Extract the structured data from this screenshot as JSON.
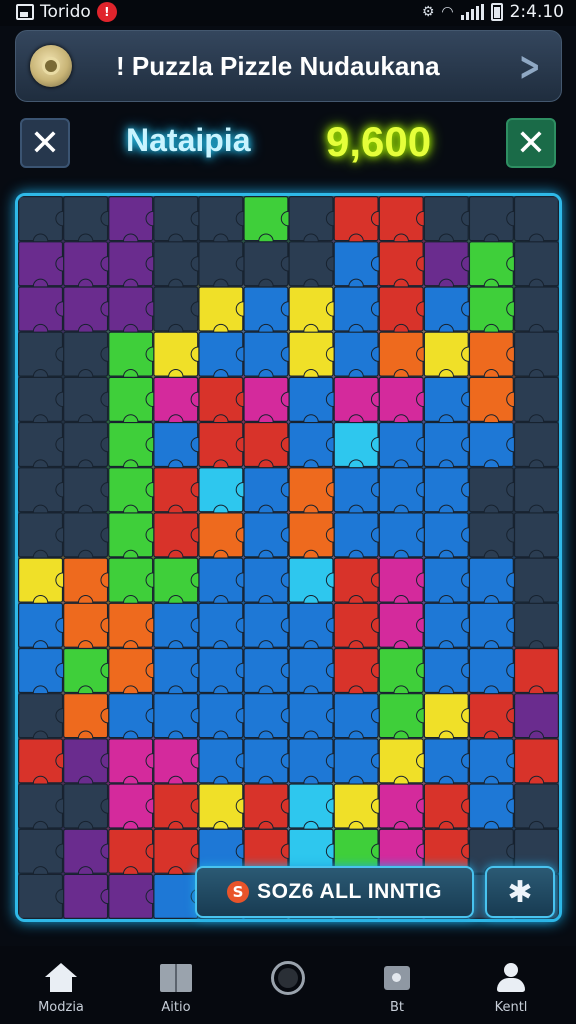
{
  "status_bar": {
    "app_text": "Torido",
    "notification_glyph": "!",
    "time": "2:4.10",
    "icons": [
      "image-icon",
      "notification-badge-icon",
      "vibrate-icon",
      "wifi-icon",
      "signal-icon",
      "battery-icon"
    ]
  },
  "title_bar": {
    "title": "! Puzzla Pizzle Nudaukana",
    "logo_icon": "puzzle-logo-icon",
    "next_icon": "chevron-right-icon"
  },
  "hud": {
    "player_name": "Nataipia",
    "score": "9,600",
    "left_button_icon": "tools-icon",
    "right_button_icon": "shuffle-icon"
  },
  "board": {
    "grid": {
      "columns": 12,
      "rows": 16
    },
    "colors": {
      "frame_glow": "#2fb9e8",
      "slate": "#2b3d52",
      "blue": "#1e78d6",
      "cyan": "#2ec7ee",
      "green": "#3fcf3a",
      "yellow": "#f0e028",
      "red": "#d8332a",
      "orange": "#ee6a1e",
      "magenta": "#d42a9c",
      "purple": "#6a2c8e",
      "gray": "#5d6670"
    },
    "placed_color_map": [
      "SSPSSGSRRSSS",
      "PPPSSSSBRPGS",
      "PPPSYBYBRBGS",
      "SSGYBBYBOYOS",
      "SSGMRMBMMBOS",
      "SSGBRRBCBBBS",
      "SSGRCBOBBBSS",
      "SSGROBOBBBSS",
      "YOGGBBCRMBBS",
      "BOOBBBBRMBBS",
      "BGOBBBBRGBBR",
      "SOBBBBBBGYRP",
      "RPMMBBBBYBBR",
      "SSMRYRCYMRBS",
      "SPRRBRCGMRSS",
      "SPPBBBYBMPSS"
    ]
  },
  "actions": {
    "solve_all_label": "SOZ6 ALL INNTIG",
    "solve_all_icon_glyph": "S",
    "settings_icon": "puzzle-piece-icon"
  },
  "nav": {
    "items": [
      {
        "label": "Modzia",
        "icon": "home-icon"
      },
      {
        "label": "Aitio",
        "icon": "book-icon"
      },
      {
        "label": "",
        "icon": "circle-icon"
      },
      {
        "label": "Bt",
        "icon": "picture-icon"
      },
      {
        "label": "Kentl",
        "icon": "profile-icon"
      }
    ]
  }
}
